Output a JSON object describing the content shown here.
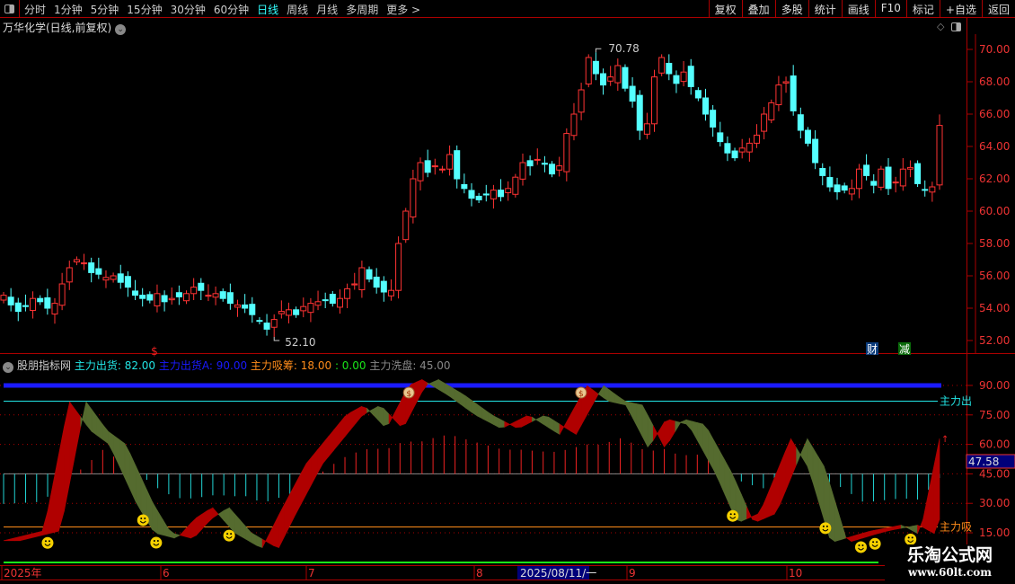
{
  "toolbar": {
    "periods": [
      "分时",
      "1分钟",
      "5分钟",
      "15分钟",
      "30分钟",
      "60分钟",
      "日线",
      "周线",
      "月线",
      "多周期",
      "更多 >"
    ],
    "active_period": "日线",
    "buttons": [
      "复权",
      "叠加",
      "多股",
      "统计",
      "画线",
      "F10",
      "标记",
      "+自选",
      "返回"
    ]
  },
  "stock_title": "万华化学(日线,前复权)",
  "price_axis": [
    "70.00",
    "68.00",
    "66.00",
    "64.00",
    "62.00",
    "60.00",
    "58.00",
    "56.00",
    "54.00",
    "52.00"
  ],
  "high_label": "70.78",
  "low_label": "52.10",
  "markers": {
    "cai": "财",
    "jian": "减",
    "dollar": "$"
  },
  "indicator": {
    "name": "股朋指标网",
    "items": [
      {
        "label": "主力出货: 82.00",
        "color": "#22e5e5"
      },
      {
        "label": "主力出货A: 90.00",
        "color": "#1a1aff"
      },
      {
        "label": "主力吸筹: 18.00",
        "color": "#ff8c1a"
      },
      {
        "label": ": 0.00",
        "color": "#1ae61a"
      },
      {
        "label": "主力洗盘: 45.00",
        "color": "#888888"
      }
    ],
    "axis": [
      "90.00",
      "75.00",
      "60.00",
      "45.00",
      "30.00",
      "15.00"
    ],
    "current": "47.58",
    "line_label_out": "主力出",
    "line_label_in": "主力吸"
  },
  "date_axis": [
    "2025年",
    "6",
    "7",
    "8",
    "2025/08/11/一",
    "9",
    "10"
  ],
  "watermark": {
    "title": "乐淘公式网",
    "url": "www.60lt.com"
  },
  "colors": {
    "up": "#ff3333",
    "down": "#54ffff",
    "band_up": "#b00000",
    "band_down": "#556b2f"
  },
  "closes": [
    54.8,
    54.2,
    53.8,
    54.1,
    54.6,
    54.4,
    54.0,
    54.3,
    55.5,
    56.5,
    57.0,
    56.8,
    56.2,
    56.1,
    55.9,
    56.0,
    55.6,
    55.3,
    54.8,
    54.6,
    54.5,
    54.9,
    54.4,
    54.6,
    54.7,
    54.9,
    55.3,
    55.1,
    54.8,
    54.9,
    54.6,
    54.3,
    54.2,
    54.0,
    53.6,
    53.2,
    52.7,
    53.3,
    53.8,
    53.9,
    53.6,
    54.1,
    54.3,
    54.4,
    54.5,
    54.3,
    54.6,
    55.2,
    55.5,
    56.5,
    55.8,
    55.3,
    55.0,
    55.1,
    58.0,
    60.0,
    62.0,
    63.0,
    62.4,
    62.8,
    62.6,
    63.5,
    62.0,
    61.4,
    60.8,
    60.7,
    61.0,
    61.3,
    60.9,
    61.4,
    62.1,
    63.0,
    62.8,
    63.2,
    62.9,
    62.3,
    62.8,
    64.8,
    66.0,
    67.5,
    69.5,
    68.5,
    67.8,
    68.3,
    69.0,
    67.6,
    66.8,
    65.0,
    65.4,
    68.3,
    69.5,
    68.5,
    67.9,
    68.6,
    67.7,
    67.0,
    66.0,
    65.2,
    64.3,
    63.6,
    63.3,
    63.9,
    64.2,
    64.7,
    66.0,
    66.7,
    67.8,
    68.0,
    66.2,
    65.0,
    64.2,
    63.0,
    62.2,
    61.5,
    61.2,
    61.3,
    61.4,
    62.6,
    62.2,
    61.6,
    62.6,
    61.4,
    61.8,
    62.6,
    62.7,
    61.7,
    61.3,
    61.5,
    65.3
  ],
  "ind_keys": [
    [
      0,
      11
    ],
    [
      0.043,
      16
    ],
    [
      0.07,
      82
    ],
    [
      0.093,
      67
    ],
    [
      0.113,
      60
    ],
    [
      0.142,
      30
    ],
    [
      0.161,
      15
    ],
    [
      0.185,
      12
    ],
    [
      0.204,
      22
    ],
    [
      0.223,
      28
    ],
    [
      0.247,
      15
    ],
    [
      0.276,
      7
    ],
    [
      0.295,
      25
    ],
    [
      0.323,
      50
    ],
    [
      0.366,
      75
    ],
    [
      0.385,
      80
    ],
    [
      0.409,
      68
    ],
    [
      0.433,
      90
    ],
    [
      0.447,
      93
    ],
    [
      0.475,
      85
    ],
    [
      0.504,
      75
    ],
    [
      0.532,
      68
    ],
    [
      0.561,
      75
    ],
    [
      0.594,
      65
    ],
    [
      0.623,
      90
    ],
    [
      0.646,
      82
    ],
    [
      0.665,
      80
    ],
    [
      0.689,
      58
    ],
    [
      0.708,
      73
    ],
    [
      0.732,
      70
    ],
    [
      0.761,
      45
    ],
    [
      0.784,
      20
    ],
    [
      0.808,
      25
    ],
    [
      0.841,
      63
    ],
    [
      0.86,
      48
    ],
    [
      0.884,
      10
    ],
    [
      0.912,
      14
    ],
    [
      0.927,
      16
    ],
    [
      0.96,
      19
    ],
    [
      0.979,
      14
    ],
    [
      1,
      63
    ]
  ],
  "smileys": [
    0.047,
    0.149,
    0.163,
    0.241,
    0.779,
    0.878,
    0.916,
    0.931,
    0.969
  ],
  "moneybags": [
    0.433,
    0.617
  ]
}
